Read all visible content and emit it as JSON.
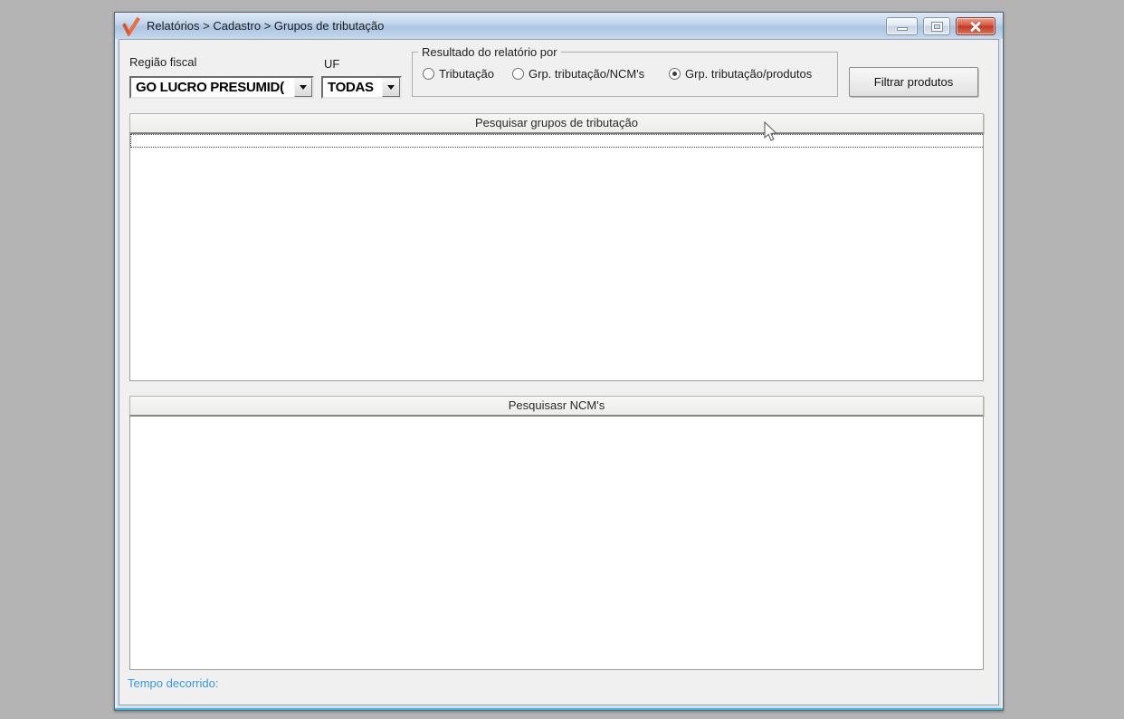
{
  "window": {
    "title": "Relatórios > Cadastro > Grupos de tributação",
    "controls": [
      "minimize",
      "maximize",
      "close"
    ]
  },
  "filters": {
    "regiao_fiscal_label": "Região fiscal",
    "regiao_fiscal_value": "GO LUCRO PRESUMID(",
    "uf_label": "UF",
    "uf_value": "TODAS"
  },
  "result_group": {
    "title": "Resultado do relatório por",
    "options": [
      {
        "label": "Tributação",
        "selected": false
      },
      {
        "label": "Grp. tributação/NCM's",
        "selected": false
      },
      {
        "label": "Grp. tributação/produtos",
        "selected": true
      }
    ]
  },
  "actions": {
    "filtrar_produtos": "Filtrar produtos"
  },
  "sections": {
    "grupos_header": "Pesquisar grupos de tributação",
    "ncms_header": "Pesquisasr NCM's"
  },
  "statusbar": {
    "tempo_decorrido": "Tempo decorrido:"
  },
  "colors": {
    "close_button": "#d9543f",
    "status_text": "#3898e3",
    "app_icon": "#e96e41"
  }
}
